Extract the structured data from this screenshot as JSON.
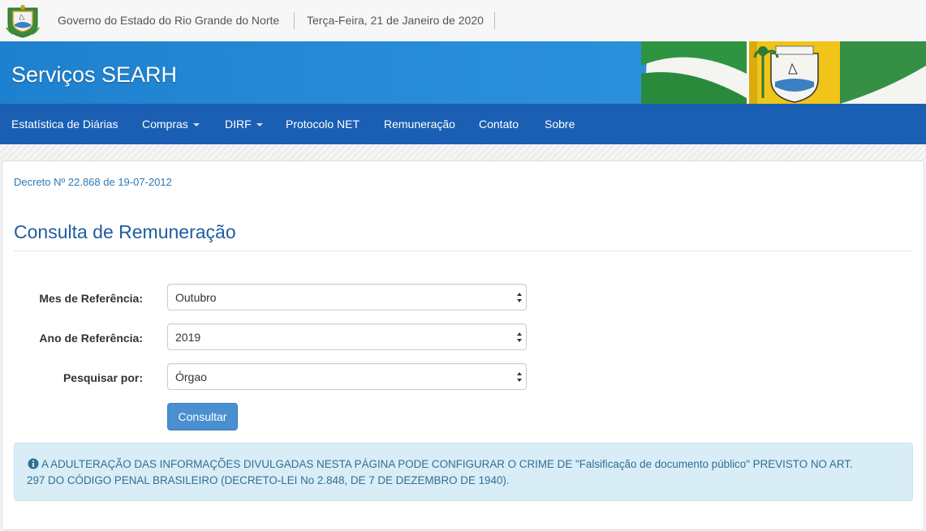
{
  "gov_bar": {
    "name": "Governo do Estado do Rio Grande do Norte",
    "date": "Terça-Feira, 21 de Janeiro de 2020"
  },
  "banner": {
    "title": "Serviços SEARH"
  },
  "nav": {
    "items": [
      {
        "label": "Estatística de Diárias"
      },
      {
        "label": "Compras"
      },
      {
        "label": "DIRF"
      },
      {
        "label": "Protocolo NET"
      },
      {
        "label": "Remuneração"
      },
      {
        "label": "Contato"
      },
      {
        "label": "Sobre"
      }
    ]
  },
  "main": {
    "decree_link": "Decreto Nº 22.868 de 19-07-2012",
    "title": "Consulta de Remuneração",
    "form": {
      "month_label": "Mes de Referência:",
      "month_value": "Outubro",
      "year_label": "Ano de Referência:",
      "year_value": "2019",
      "search_label": "Pesquisar por:",
      "search_value": "Órgao",
      "submit_label": "Consultar"
    },
    "alert": {
      "line1": "A ADULTERAÇÃO DAS INFORMAÇÕES DIVULGADAS NESTA PÁGINA PODE CONFIGURAR O CRIME DE \"Falsificação de documento público\" PREVISTO NO ART.",
      "line2": "297 DO CÓDIGO PENAL BRASILEIRO (DECRETO-LEI No 2.848, DE 7 DE DEZEMBRO DE 1940)."
    }
  },
  "colors": {
    "banner": "#2a8fdb",
    "navbar": "#1a5fb4",
    "primary_button": "#4a8fcf",
    "title": "#1f5d9f",
    "alert_bg": "#d9edf7",
    "alert_text": "#31708f"
  },
  "icons": {
    "gov_logo": "state-coat-of-arms-icon",
    "banner_flag": "rn-flag-icon",
    "select_arrows": "updown-arrows-icon",
    "alert": "info-circle-icon"
  }
}
